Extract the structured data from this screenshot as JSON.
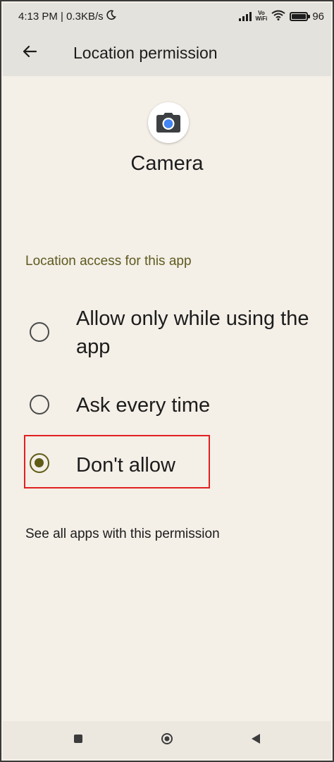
{
  "status_bar": {
    "time_speed": "4:13 PM | 0.3KB/s",
    "vowifi_top": "Vo",
    "vowifi_bottom": "WiFi",
    "battery_text": "96",
    "battery_level": 0.96
  },
  "app_bar": {
    "title": "Location permission"
  },
  "app": {
    "name": "Camera"
  },
  "section": {
    "title": "Location access for this app"
  },
  "options": [
    {
      "label": "Allow only while using the app",
      "selected": false
    },
    {
      "label": "Ask every time",
      "selected": false
    },
    {
      "label": "Don't allow",
      "selected": true
    }
  ],
  "see_all_link": "See all apps with this permission",
  "icons": {
    "back": "arrow-left-icon",
    "app": "camera-icon",
    "moon": "moon-icon",
    "signal": "signal-icon",
    "wifi": "wifi-icon",
    "battery": "battery-icon",
    "nav_recents": "square-icon",
    "nav_home": "circle-icon",
    "nav_back": "triangle-icon"
  },
  "colors": {
    "background": "#f4efe7",
    "bar": "#e4e2dc",
    "accent": "#5f5c16",
    "highlight": "#e02020"
  }
}
